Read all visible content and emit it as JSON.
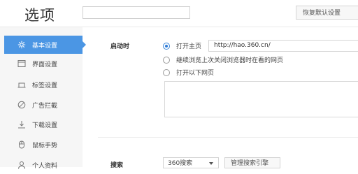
{
  "header": {
    "title": "选项",
    "search_placeholder": "",
    "restore_label": "恢复默认设置"
  },
  "sidebar": {
    "items": [
      {
        "label": "基本设置",
        "icon": "gear-icon",
        "active": true
      },
      {
        "label": "界面设置",
        "icon": "window-icon",
        "active": false
      },
      {
        "label": "标签设置",
        "icon": "tab-icon",
        "active": false
      },
      {
        "label": "广告拦截",
        "icon": "block-icon",
        "active": false
      },
      {
        "label": "下载设置",
        "icon": "download-icon",
        "active": false
      },
      {
        "label": "鼠标手势",
        "icon": "mouse-icon",
        "active": false
      },
      {
        "label": "个人资料",
        "icon": "person-icon",
        "active": false
      }
    ]
  },
  "startup": {
    "label": "启动时",
    "options": [
      {
        "label": "打开主页",
        "checked": true
      },
      {
        "label": "继续浏览上次关闭浏览器时在看的网页",
        "checked": false
      },
      {
        "label": "打开以下网页",
        "checked": false
      }
    ],
    "homepage_url": "http://hao.360.cn/"
  },
  "search": {
    "label": "搜索",
    "engine_selected": "360搜索",
    "manage_label": "管理搜索引擎"
  },
  "colors": {
    "accent": "#4b96e4",
    "sidebar_bg": "#f6f6f6"
  }
}
